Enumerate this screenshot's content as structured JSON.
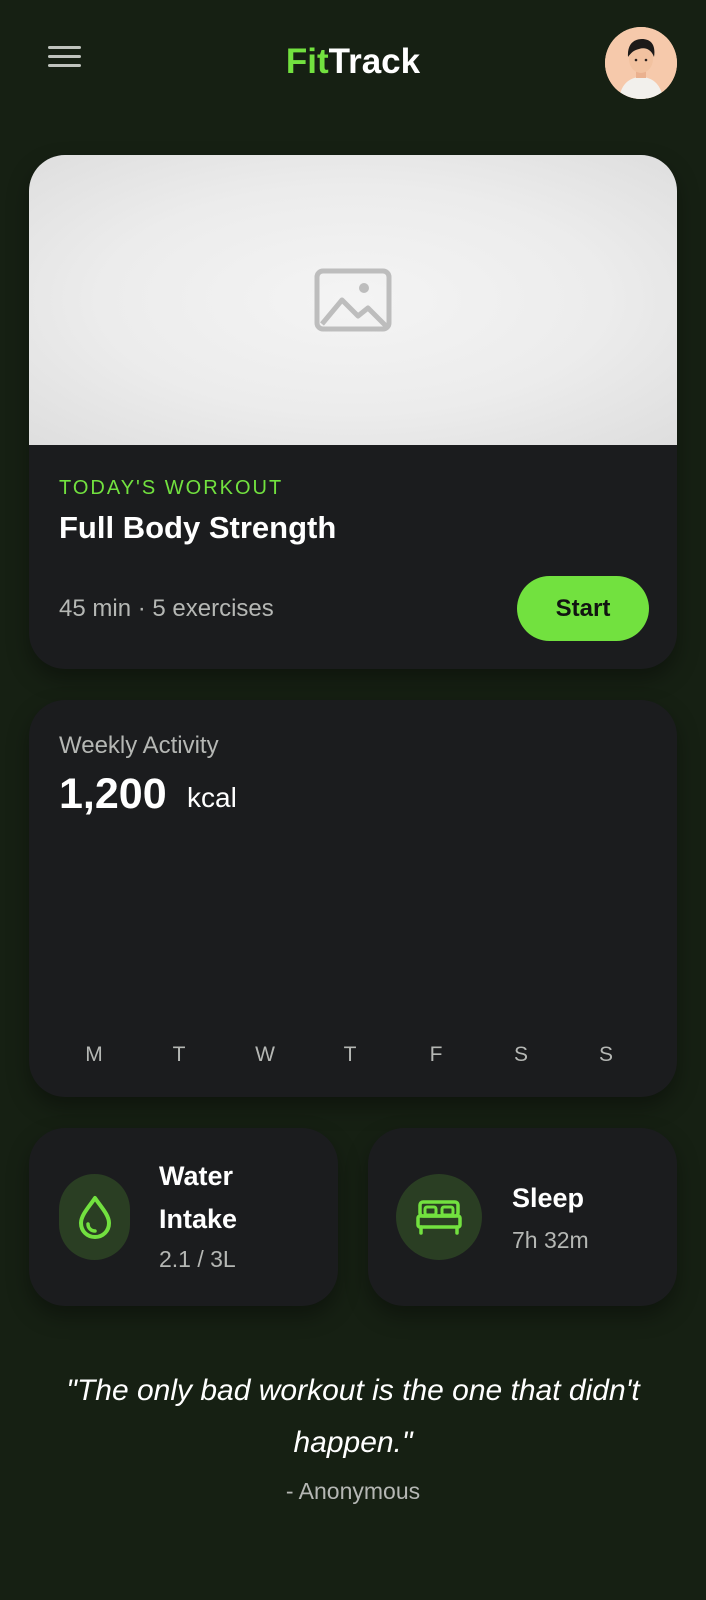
{
  "header": {
    "logo_part1": "Fit",
    "logo_part2": "Track",
    "menu_icon": "hamburger-menu-icon",
    "avatar_alt": "User avatar"
  },
  "workout": {
    "eyebrow": "TODAY'S WORKOUT",
    "title": "Full Body Strength",
    "meta": "45 min · 5 exercises",
    "start_label": "Start",
    "image_icon": "image-placeholder-icon"
  },
  "activity": {
    "label": "Weekly Activity",
    "value": "1,200",
    "unit": "kcal",
    "days": [
      "M",
      "T",
      "W",
      "T",
      "F",
      "S",
      "S"
    ]
  },
  "stats": {
    "water": {
      "title": "Water Intake",
      "value": "2.1 / 3L",
      "icon": "water-drop-icon"
    },
    "sleep": {
      "title": "Sleep",
      "value": "7h 32m",
      "icon": "bed-icon"
    }
  },
  "quote": {
    "text": "\"The only bad workout is the one that didn't happen.\"",
    "author": "- Anonymous"
  },
  "colors": {
    "accent": "#72e13f",
    "background": "#162013",
    "card": "#1b1c1e",
    "muted_text": "#b5b7b4",
    "icon_circle": "#2a3e23"
  }
}
